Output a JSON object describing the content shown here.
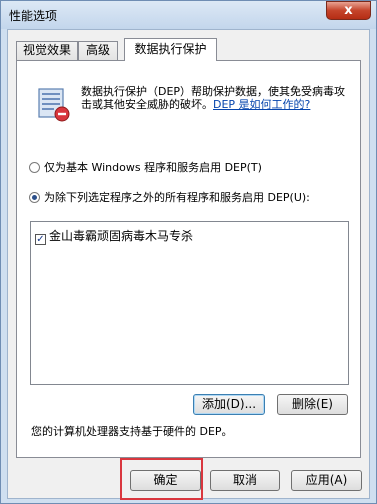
{
  "window": {
    "title": "性能选项",
    "close_glyph": "x"
  },
  "tabs": [
    {
      "label": "视觉效果",
      "active": false
    },
    {
      "label": "高级",
      "active": false
    },
    {
      "label": "数据执行保护",
      "active": true
    }
  ],
  "dep": {
    "icon": "dep-shield-icon",
    "description": "数据执行保护（DEP）帮助保护数据，使其免受病毒攻击或其他安全威胁的破坏。",
    "link_text": "DEP 是如何工作的?",
    "option_basic": "仅为基本 Windows 程序和服务启用 DEP(T)",
    "option_all_except": "为除下列选定程序之外的所有程序和服务启用 DEP(U):",
    "selected_option": "all_except",
    "programs": [
      {
        "name": "金山毒霸顽固病毒木马专杀",
        "checked": true
      }
    ],
    "add_label": "添加(D)...",
    "remove_label": "删除(E)",
    "support_text": "您的计算机处理器支持基于硬件的 DEP。"
  },
  "footer": {
    "ok_label": "确定",
    "cancel_label": "取消",
    "apply_label": "应用(A)"
  },
  "highlight_color": "#d9363e"
}
